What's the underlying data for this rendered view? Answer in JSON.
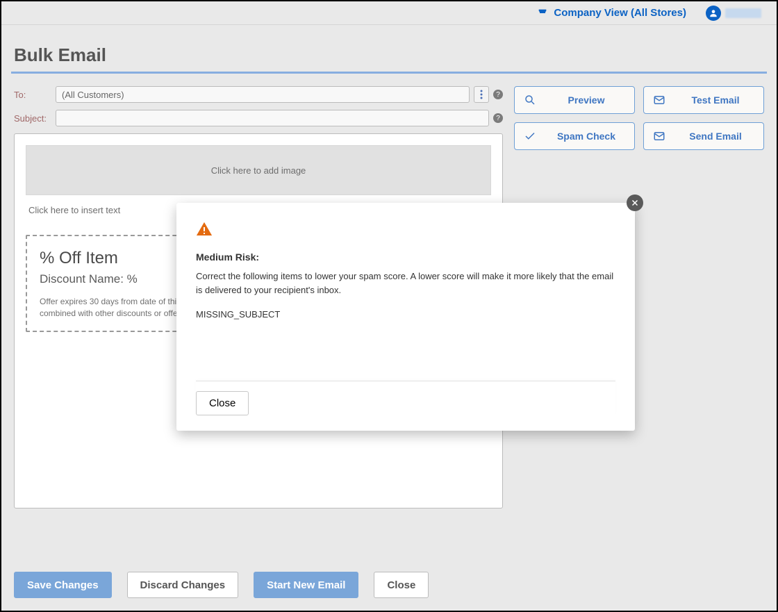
{
  "topbar": {
    "company_view_label": "Company View (All Stores)"
  },
  "page": {
    "title": "Bulk Email"
  },
  "form": {
    "to_label": "To:",
    "to_value": "(All Customers)",
    "subject_label": "Subject:",
    "subject_value": ""
  },
  "editor": {
    "image_placeholder": "Click here to add image",
    "text_placeholder": "Click here to insert text",
    "coupon": {
      "title": "% Off Item",
      "subtitle": "Discount Name: %",
      "fineprint": "Offer expires 30 days from date of this email. Must present this coupon. One coupon per customer. Cannot be combined with other discounts or offers."
    }
  },
  "actions": {
    "preview": "Preview",
    "test_email": "Test Email",
    "spam_check": "Spam Check",
    "send_email": "Send Email"
  },
  "bottom": {
    "save": "Save Changes",
    "discard": "Discard Changes",
    "start_new": "Start New Email",
    "close": "Close"
  },
  "modal": {
    "title": "Medium Risk:",
    "body": "Correct the following items to lower your spam score. A lower score will make it more likely that the email is delivered to your recipient's inbox.",
    "code": "MISSING_SUBJECT",
    "close": "Close"
  }
}
